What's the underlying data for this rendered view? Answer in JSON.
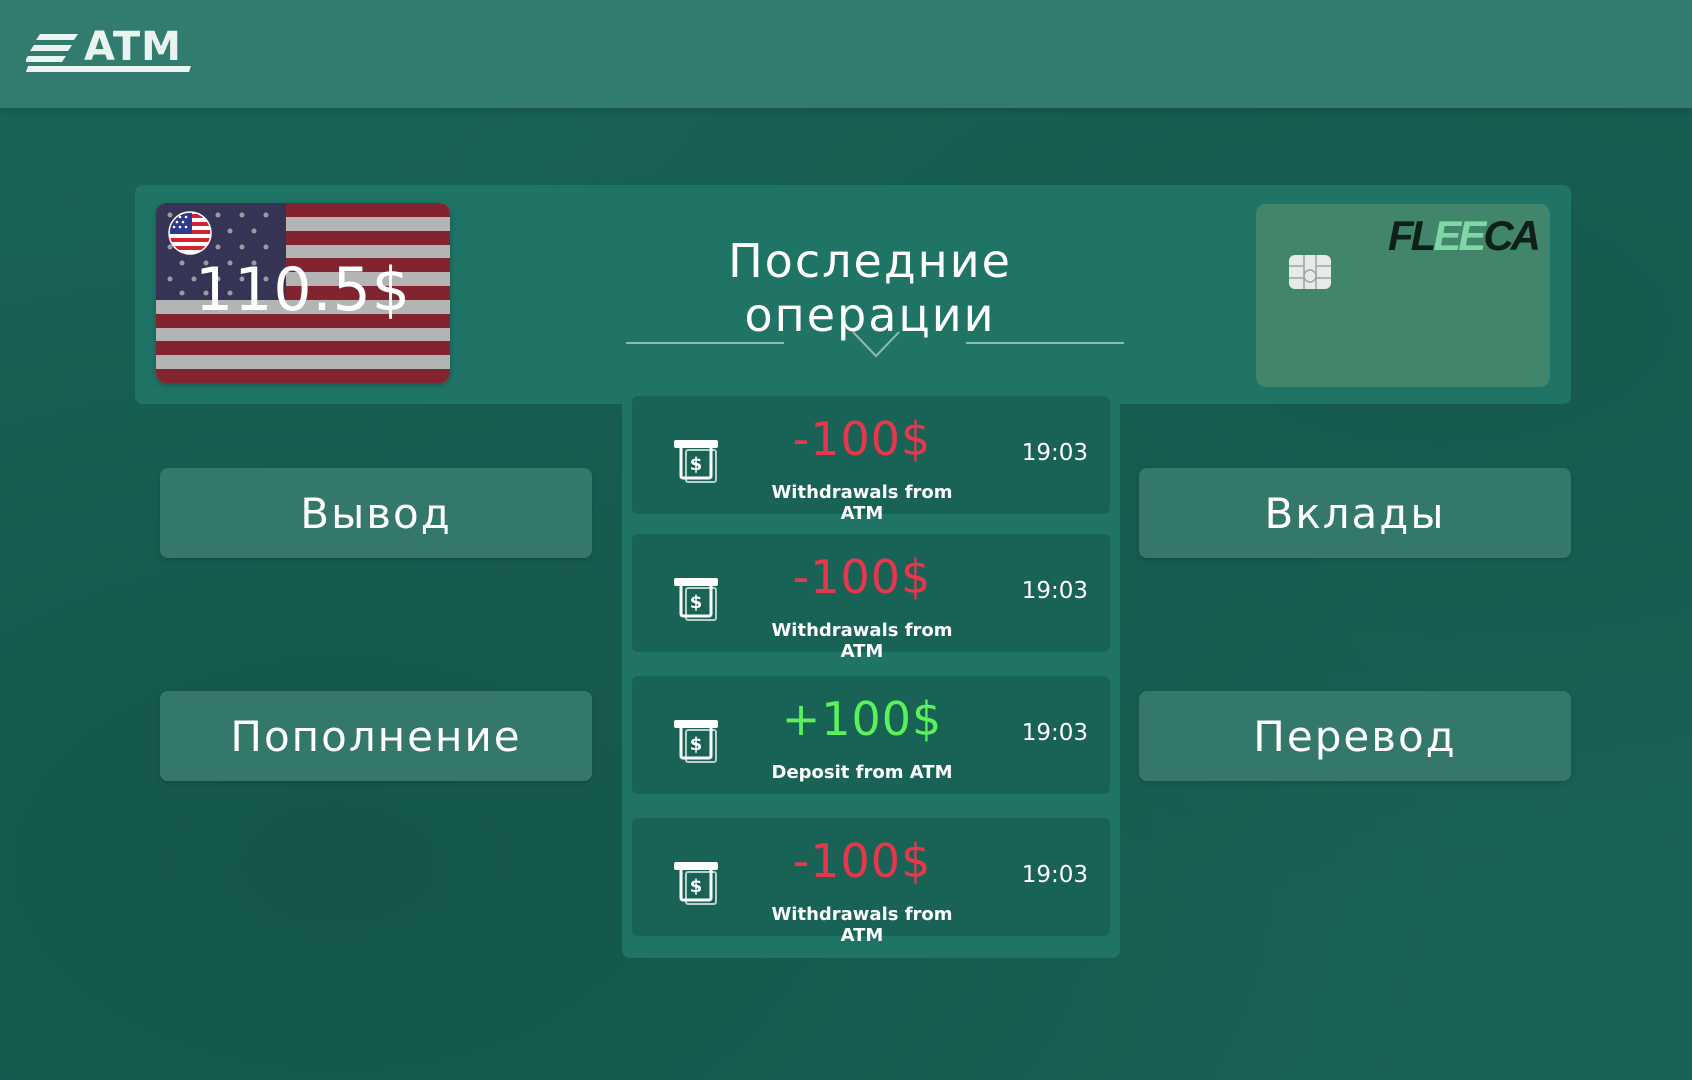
{
  "header": {
    "logo_text": "ATM"
  },
  "balance": {
    "amount": "110.5$",
    "currency_icon": "us-flag-icon"
  },
  "operations": {
    "title": "Последние операции",
    "items": [
      {
        "amount": "-100$",
        "type": "negative",
        "description": "Withdrawals from ATM",
        "time": "19:03",
        "icon": "atm-cash-icon"
      },
      {
        "amount": "-100$",
        "type": "negative",
        "description": "Withdrawals from ATM",
        "time": "19:03",
        "icon": "atm-cash-icon"
      },
      {
        "amount": "+100$",
        "type": "positive",
        "description": "Deposit from ATM",
        "time": "19:03",
        "icon": "atm-cash-icon"
      },
      {
        "amount": "-100$",
        "type": "negative",
        "description": "Withdrawals from ATM",
        "time": "19:03",
        "icon": "atm-cash-icon"
      }
    ]
  },
  "bank_card": {
    "brand_part1": "FL",
    "brand_part2": "EE",
    "brand_part3": "CA",
    "chip_icon": "card-chip-icon"
  },
  "actions": {
    "withdraw": "Вывод",
    "deposit": "Пополнение",
    "savings": "Вклады",
    "transfer": "Перевод"
  },
  "colors": {
    "background": "#196356",
    "topbar": "#317c6e",
    "panel": "#1f7466",
    "button": "#34786b",
    "negative": "#e8364c",
    "positive": "#5af15a",
    "card": "#41866a"
  }
}
